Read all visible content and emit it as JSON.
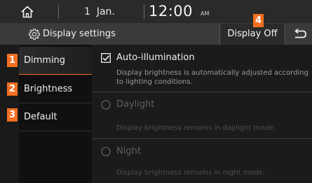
{
  "status": {
    "day": "1",
    "month": "Jan.",
    "time": "12:00",
    "ampm": "AM"
  },
  "header": {
    "title": "Display settings",
    "display_off_label": "Display Off"
  },
  "menu": {
    "items": [
      {
        "label": "Dimming",
        "selected": true
      },
      {
        "label": "Brightness",
        "selected": false
      },
      {
        "label": "Default",
        "selected": false
      }
    ]
  },
  "markers": [
    "1",
    "2",
    "3",
    "4"
  ],
  "options": [
    {
      "label": "Auto-illumination",
      "description": "Display brightness is automatically adjusted according to lighting conditions.",
      "control": "checkbox",
      "checked": true,
      "enabled": true
    },
    {
      "label": "Daylight",
      "description": "Display brightness remains in daylight mode.",
      "control": "radio",
      "checked": false,
      "enabled": false
    },
    {
      "label": "Night",
      "description": "Display brightness remains in night mode.",
      "control": "radio",
      "checked": false,
      "enabled": false
    }
  ],
  "colors": {
    "accent": "#f37021",
    "background": "#1a1a1a",
    "titlebar": "#3a3a3a"
  },
  "icons": {
    "home": "home-icon",
    "gear": "gear-icon",
    "back": "back-arrow-icon"
  }
}
